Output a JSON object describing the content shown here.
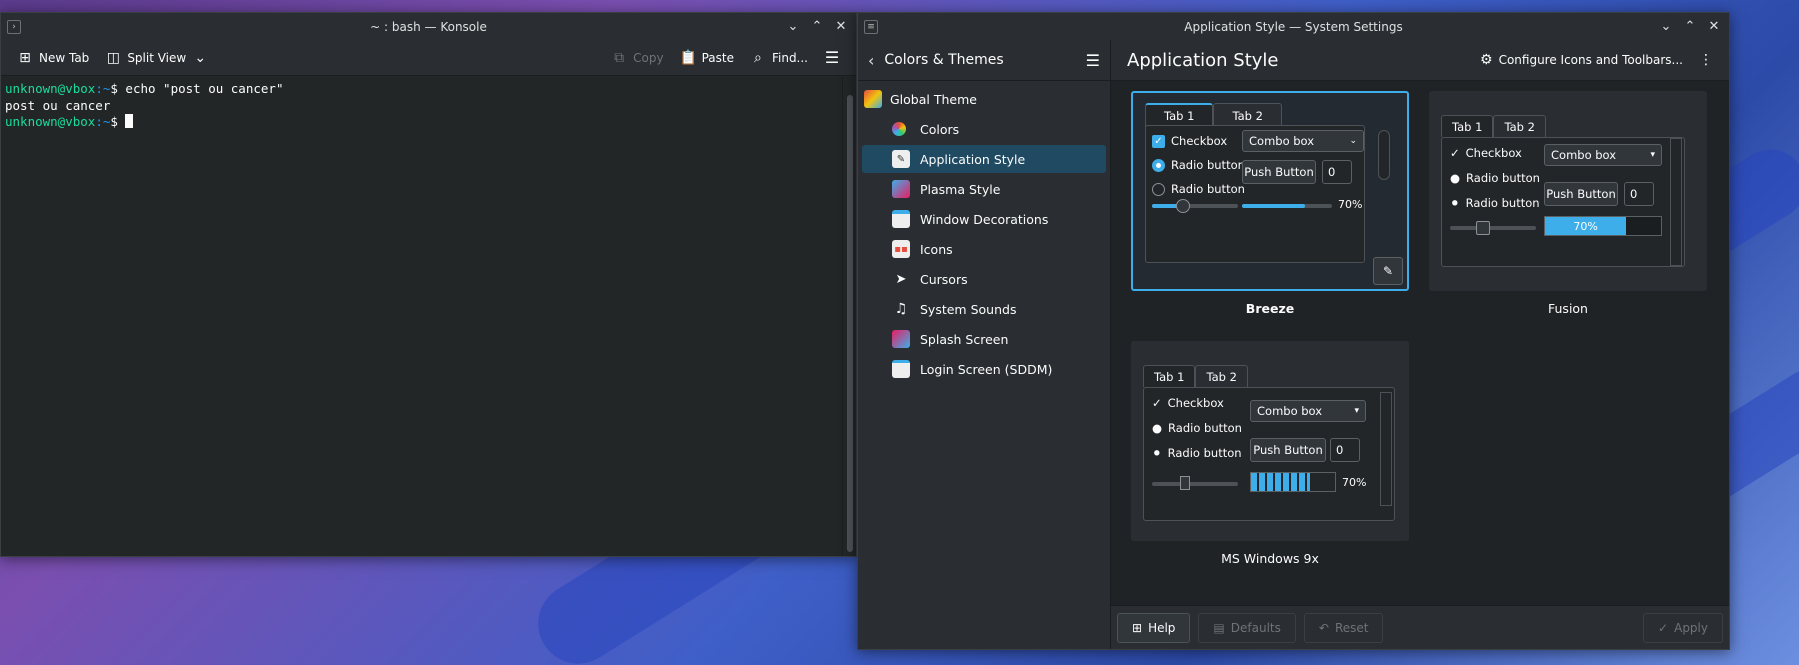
{
  "konsole": {
    "title": "~ : bash — Konsole",
    "toolbar": {
      "new_tab": "New Tab",
      "split_view": "Split View",
      "copy": "Copy",
      "paste": "Paste",
      "find": "Find..."
    },
    "terminal": {
      "line1_user": "unknown@vbox",
      "line1_path": ":~",
      "line1_cmd": "$ echo \"post ou cancer\"",
      "line2": "post ou cancer",
      "line3_user": "unknown@vbox",
      "line3_path": ":~",
      "line3_prompt": "$ "
    }
  },
  "settings": {
    "title": "Application Style — System Settings",
    "sidebar": {
      "header": "Colors & Themes",
      "items": [
        {
          "label": "Global Theme"
        },
        {
          "label": "Colors"
        },
        {
          "label": "Application Style"
        },
        {
          "label": "Plasma Style"
        },
        {
          "label": "Window Decorations"
        },
        {
          "label": "Icons"
        },
        {
          "label": "Cursors"
        },
        {
          "label": "System Sounds"
        },
        {
          "label": "Splash Screen"
        },
        {
          "label": "Login Screen (SDDM)"
        }
      ]
    },
    "page_title": "Application Style",
    "configure": "Configure Icons and Toolbars...",
    "styles": [
      {
        "name": "Breeze",
        "selected": true
      },
      {
        "name": "Fusion",
        "selected": false
      },
      {
        "name": "MS Windows 9x",
        "selected": false
      }
    ],
    "preview": {
      "tab1": "Tab 1",
      "tab2": "Tab 2",
      "checkbox": "Checkbox",
      "radio": "Radio button",
      "combo": "Combo box",
      "push": "Push Button",
      "spin": "0",
      "percent": "70%",
      "progress": 0.7
    },
    "buttons": {
      "help": "Help",
      "defaults": "Defaults",
      "reset": "Reset",
      "apply": "Apply"
    }
  },
  "colors": {
    "accent": "#3daee9",
    "selection": "#1f4a61",
    "prompt_user": "#1cdc9a",
    "prompt_path": "#1d99f3"
  }
}
